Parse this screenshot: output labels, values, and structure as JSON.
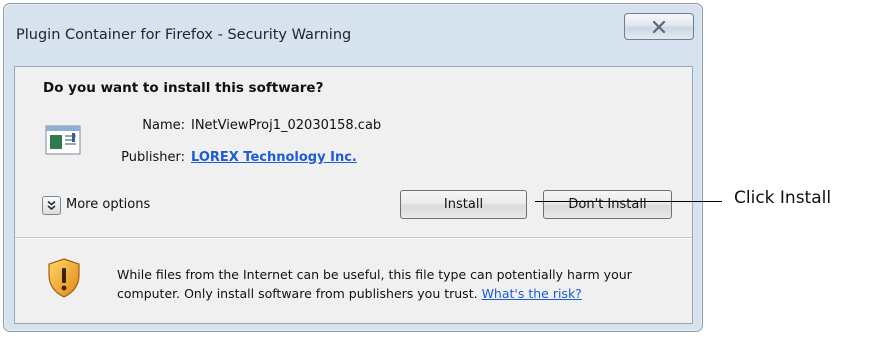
{
  "dialog": {
    "title": "Plugin Container for Firefox - Security Warning",
    "close_icon": "close-icon",
    "question": "Do you want to install this software?",
    "file_icon": "file-icon",
    "name_label": "Name:",
    "name_value": "INetViewProj1_02030158.cab",
    "publisher_label": "Publisher:",
    "publisher_value": "LOREX Technology Inc.",
    "more_options_icon": "chevron-down-icon",
    "more_options_label": "More options",
    "install_label": "Install",
    "dont_install_label": "Don't Install",
    "warning_icon": "shield-icon",
    "warning_text": "While files from the Internet can be useful, this file type can potentially harm your computer. Only install software from publishers you trust.",
    "risk_link": "What's the risk?"
  },
  "annotation": {
    "label": "Click Install"
  },
  "colors": {
    "dialog_frame": "#d6e2ee",
    "panel": "#f0f0f0",
    "link": "#1e5bd6",
    "shield": "#f2b02a"
  }
}
